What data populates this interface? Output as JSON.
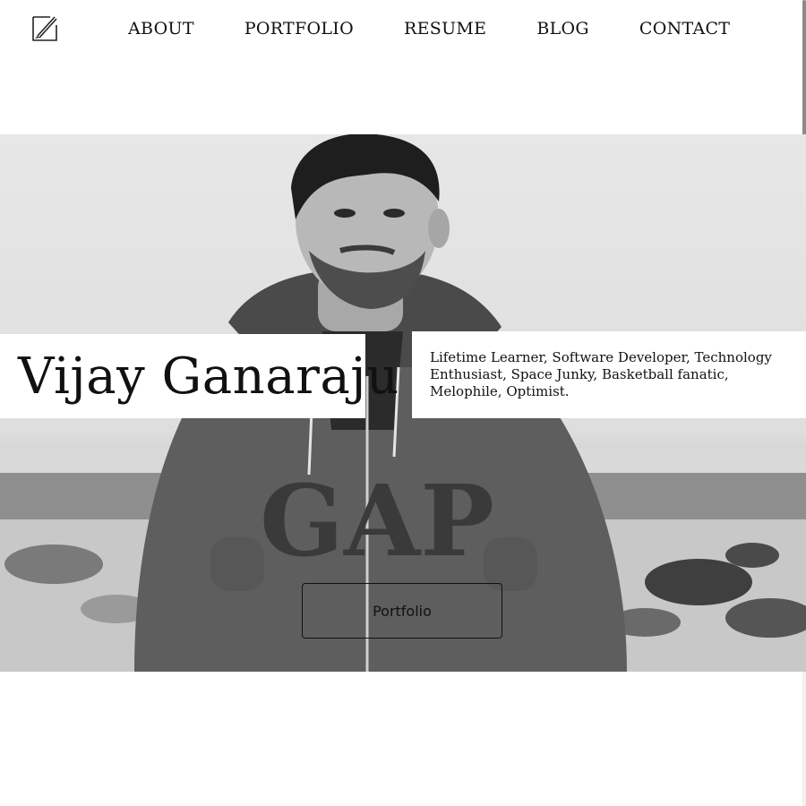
{
  "header": {
    "logo_icon": "pen-square-icon",
    "nav": [
      {
        "label": "ABOUT"
      },
      {
        "label": "PORTFOLIO"
      },
      {
        "label": "RESUME"
      },
      {
        "label": "BLOG"
      },
      {
        "label": "CONTACT"
      }
    ]
  },
  "hero": {
    "name": "Vijay Ganaraju",
    "tagline": "Lifetime Learner, Software Developer, Technology Enthusiast, Space Junky, Basketball fanatic, Melophile, Optimist.",
    "button_label": "Portfolio",
    "photo_icon": "person-photo-icon",
    "shirt_text": "GAP"
  }
}
